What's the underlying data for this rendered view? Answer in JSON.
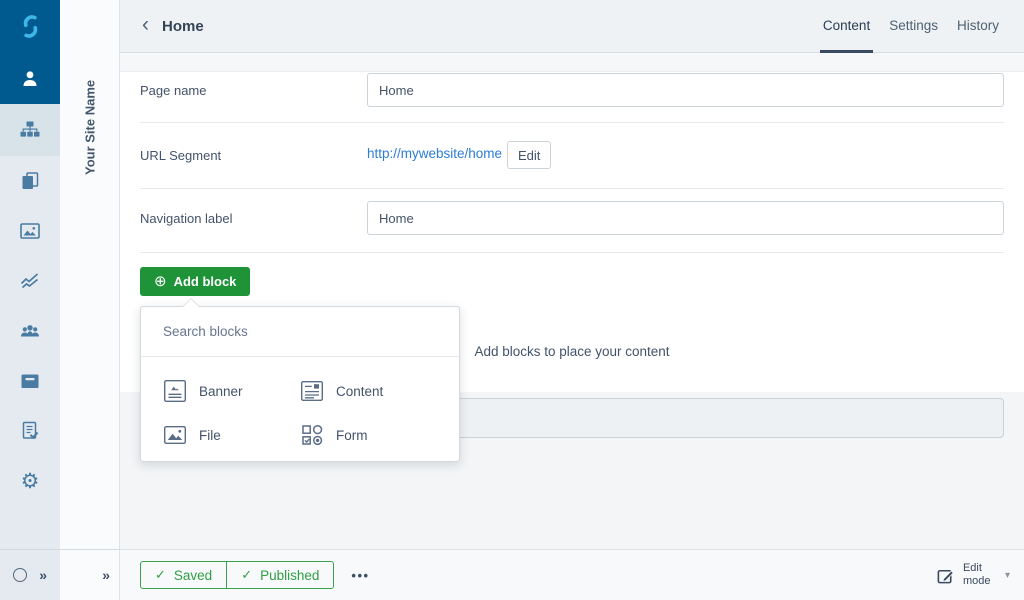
{
  "site_label": "Your Site Name",
  "header": {
    "title": "Home",
    "tabs": [
      {
        "label": "Content",
        "active": true
      },
      {
        "label": "Settings",
        "active": false
      },
      {
        "label": "History",
        "active": false
      }
    ]
  },
  "sidebar": {
    "items": [
      {
        "icon": "silverstripe-logo"
      },
      {
        "icon": "user-icon",
        "active": true
      },
      {
        "icon": "sitemap-icon",
        "current": true
      },
      {
        "icon": "pages-icon"
      },
      {
        "icon": "images-icon"
      },
      {
        "icon": "reports-icon"
      },
      {
        "icon": "users-icon"
      },
      {
        "icon": "archive-icon"
      },
      {
        "icon": "campaigns-icon"
      },
      {
        "icon": "settings-gear-icon"
      }
    ],
    "bottom_icons": [
      "status-circle-icon",
      "collapse-chevrons-icon"
    ]
  },
  "form": {
    "page_name": {
      "label": "Page name",
      "value": "Home"
    },
    "url_segment": {
      "label": "URL Segment",
      "link": "http://mywebsite/home",
      "edit_label": "Edit"
    },
    "nav_label": {
      "label": "Navigation label",
      "value": "Home"
    },
    "add_block_label": "Add block",
    "empty_hint": "Add blocks to place your content"
  },
  "popover": {
    "search_placeholder": "Search blocks",
    "blocks": [
      {
        "label": "Banner",
        "icon": "banner-block-icon"
      },
      {
        "label": "Content",
        "icon": "content-block-icon"
      },
      {
        "label": "File",
        "icon": "file-block-icon"
      },
      {
        "label": "Form",
        "icon": "form-block-icon"
      }
    ]
  },
  "toolbar": {
    "saved_label": "Saved",
    "published_label": "Published",
    "more_label": "•••",
    "edit_mode_label": "Edit mode"
  },
  "icons": {
    "back": "‹",
    "plus_circle": "⊕",
    "check": "✓",
    "caret_down": "▾",
    "collapse": "»",
    "gear": "⚙"
  },
  "colors": {
    "brand_blue": "#00598f",
    "brand_cyan": "#3db6e8",
    "accent_green": "#1f9338",
    "toolbar_green": "#2f9e44",
    "link_blue": "#2e7cd4",
    "tab_underline": "#3a4b61",
    "sidebar_bg": "#e4eaef",
    "header_bg": "#eef2f5"
  }
}
